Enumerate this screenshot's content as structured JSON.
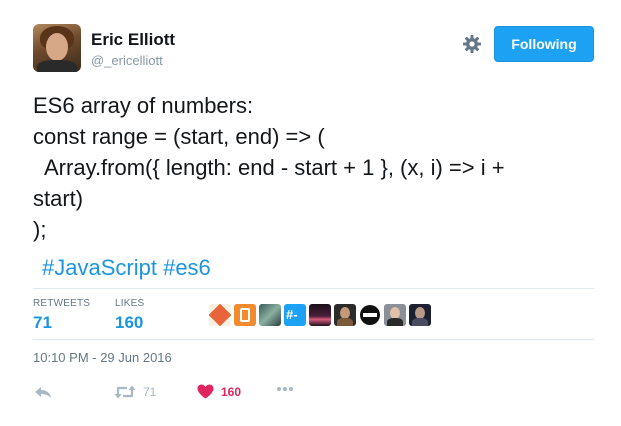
{
  "user": {
    "name": "Eric Elliott",
    "handle": "@_ericelliott",
    "follow_label": "Following"
  },
  "tweet": {
    "lines": [
      "ES6 array of numbers:",
      "const range = (start, end) => (",
      "  Array.from({ length: end - start + 1 }, (x, i) => i +",
      "start)",
      ");"
    ],
    "hashtags": [
      "#JavaScript",
      "#es6"
    ]
  },
  "stats": {
    "retweets_label": "RETWEETS",
    "retweets_value": "71",
    "likes_label": "LIKES",
    "likes_value": "160"
  },
  "timestamp": "10:10 PM - 29 Jun 2016",
  "actions": {
    "retweet_count": "71",
    "like_count": "160"
  },
  "colors": {
    "accent": "#1da1f2",
    "link": "#1b95e0",
    "like": "#e0245e"
  },
  "icons": [
    "gear-icon",
    "reply-icon",
    "retweet-icon",
    "heart-icon",
    "more-icon"
  ]
}
